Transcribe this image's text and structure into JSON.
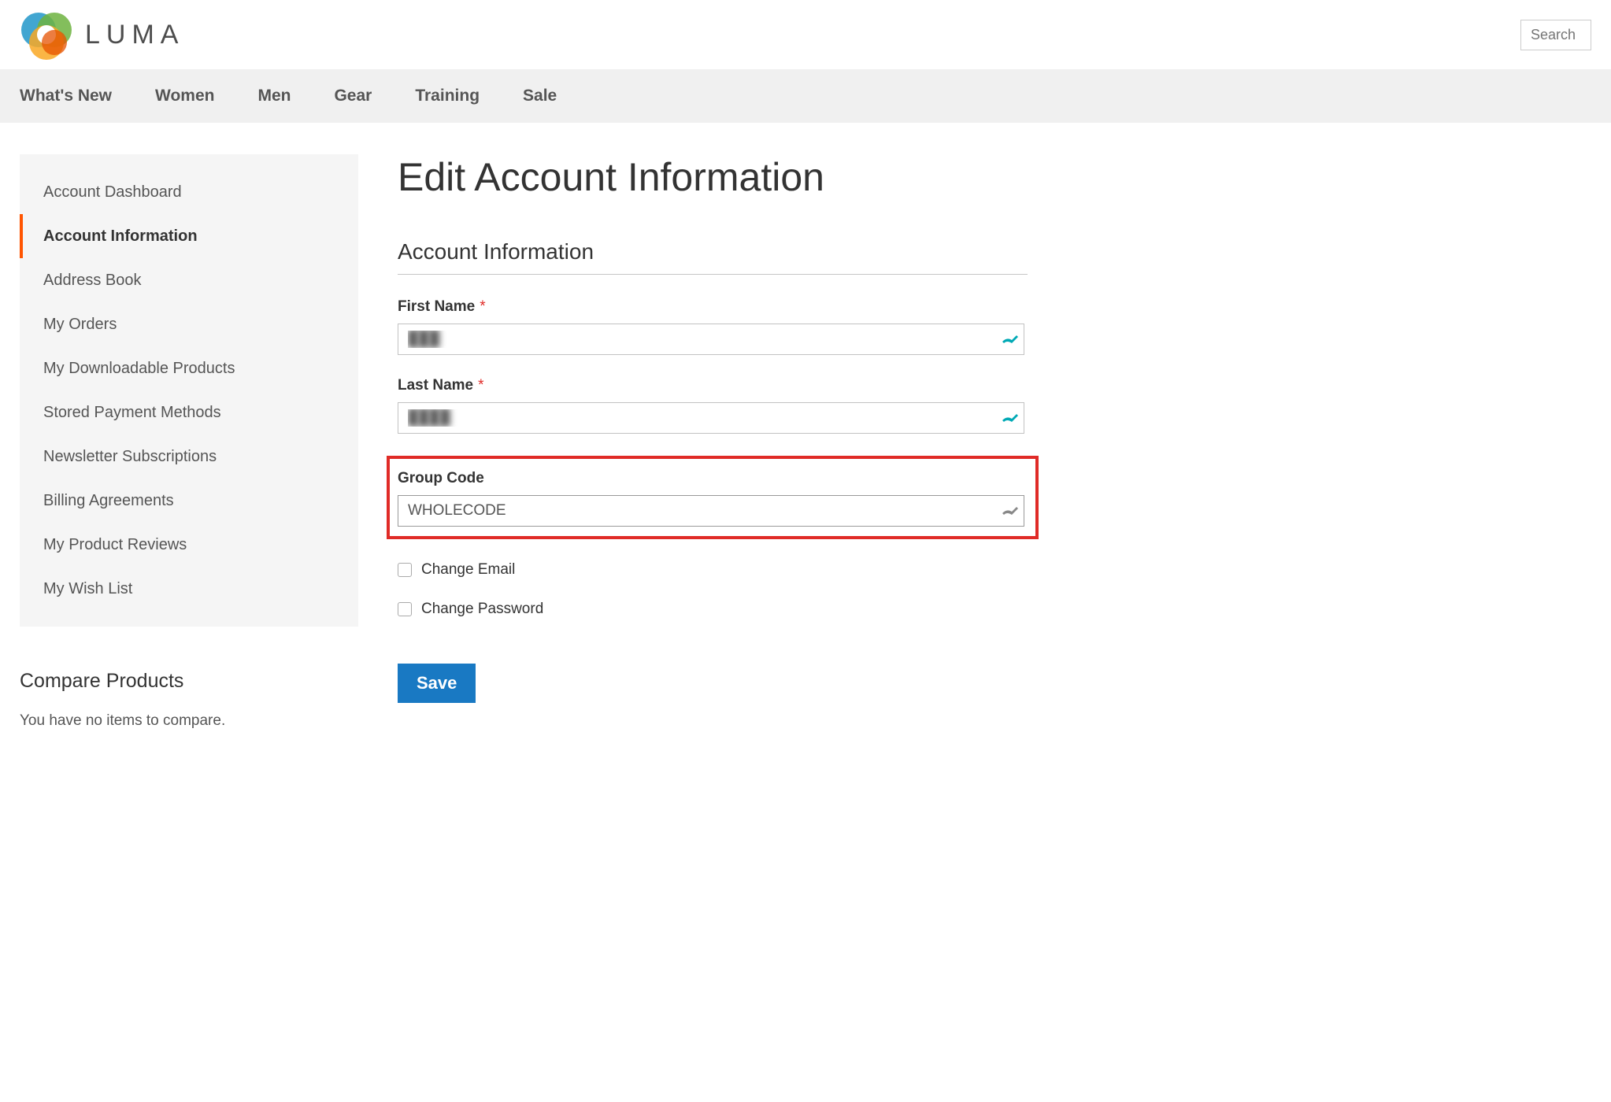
{
  "header": {
    "brand": "LUMA",
    "search_placeholder": "Search"
  },
  "nav": {
    "items": [
      "What's New",
      "Women",
      "Men",
      "Gear",
      "Training",
      "Sale"
    ]
  },
  "sidebar": {
    "items": [
      "Account Dashboard",
      "Account Information",
      "Address Book",
      "My Orders",
      "My Downloadable Products",
      "Stored Payment Methods",
      "Newsletter Subscriptions",
      "Billing Agreements",
      "My Product Reviews",
      "My Wish List"
    ]
  },
  "compare": {
    "title": "Compare Products",
    "message": "You have no items to compare."
  },
  "page": {
    "title": "Edit Account Information",
    "section_title": "Account Information"
  },
  "form": {
    "first_name": {
      "label": "First Name",
      "value": "███"
    },
    "last_name": {
      "label": "Last Name",
      "value": "████"
    },
    "group_code": {
      "label": "Group Code",
      "value": "WHOLECODE"
    },
    "change_email_label": "Change Email",
    "change_password_label": "Change Password",
    "save_label": "Save",
    "required_mark": "*"
  }
}
